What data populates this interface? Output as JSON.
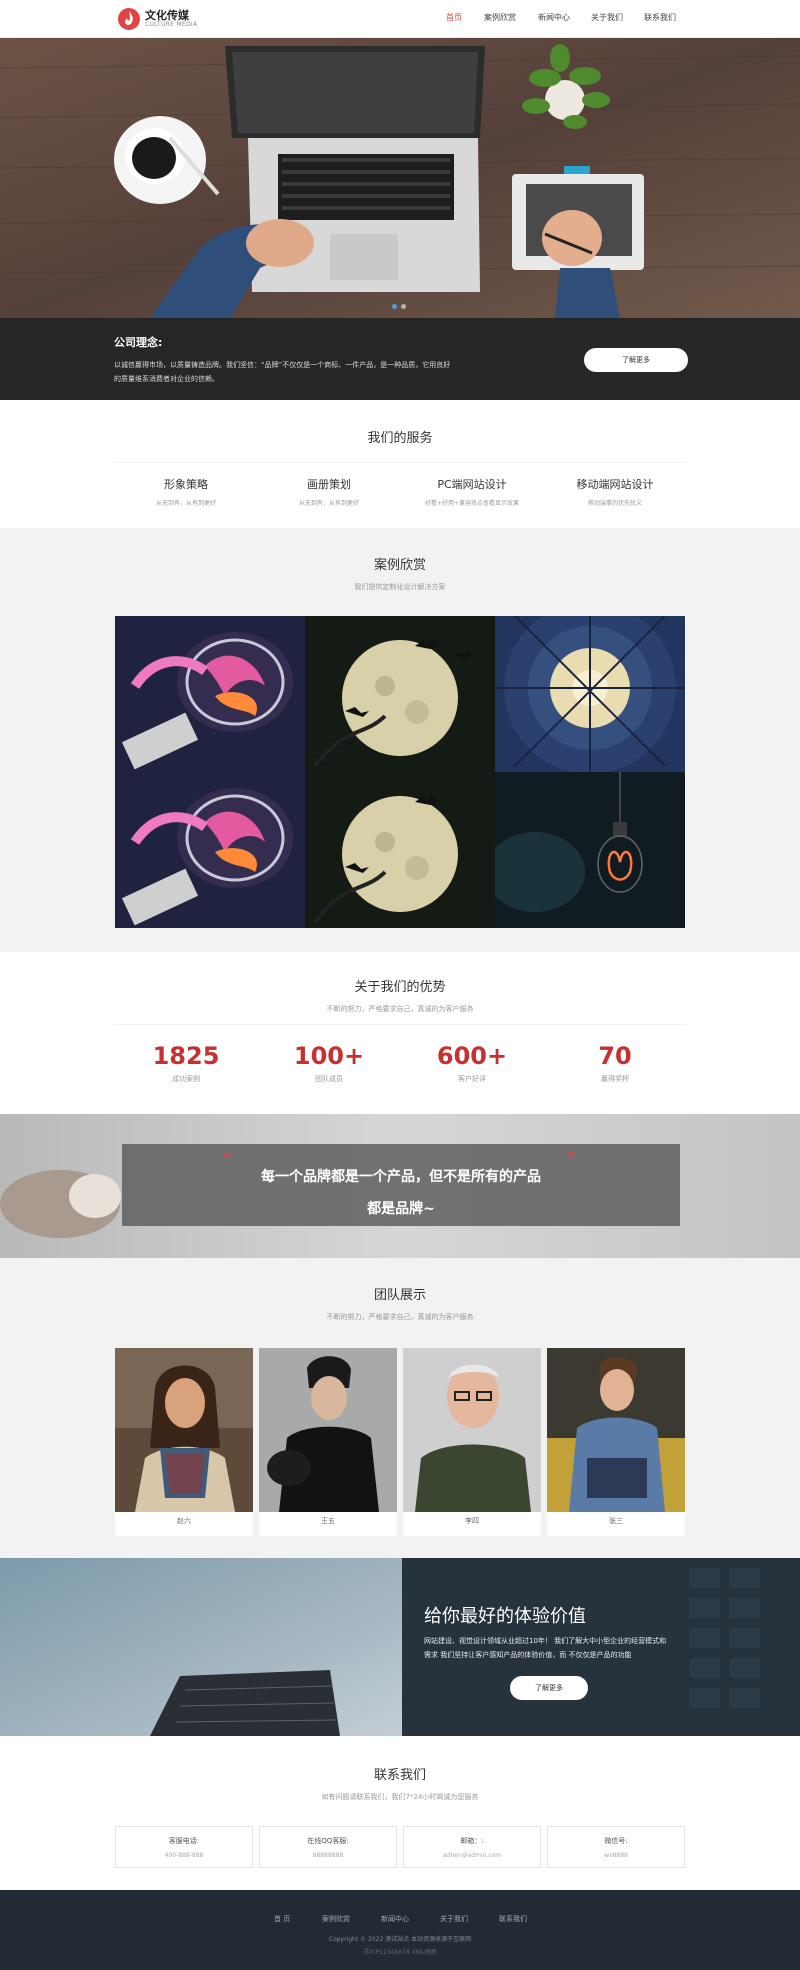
{
  "header": {
    "logo_title": "文化传媒",
    "logo_subtitle": "CULTURE MEDIA",
    "nav": [
      "首页",
      "案例欣赏",
      "新闻中心",
      "关于我们",
      "联系我们"
    ],
    "nav_active_index": 0,
    "accent_color": "#e04545"
  },
  "hero": {
    "dots": 2,
    "active_dot": 0
  },
  "concept": {
    "title": "公司理念:",
    "text": "以诚信赢得市场，以质量铸造品牌。我们坚信：“品牌”不仅仅是一个商标、一件产品，是一种品质，它用良好的质量维系消费者对企业的信赖。",
    "button": "了解更多"
  },
  "services": {
    "title": "我们的服务",
    "items": [
      {
        "name": "形象策略",
        "desc": "从无到有，从有到更好"
      },
      {
        "name": "画册策划",
        "desc": "从无到有，从有到更好"
      },
      {
        "name": "PC端网站设计",
        "desc": "好看+好用+兼容热点查看显示效果"
      },
      {
        "name": "移动端网站设计",
        "desc": "移动端事的优先优义"
      }
    ]
  },
  "cases": {
    "title": "案例欣赏",
    "subtitle": "我们提供定制化设计解决方案",
    "images": [
      "bulb-image",
      "moon-image",
      "dome-image",
      "bulb-image",
      "moon-image",
      "filament-bulb-image"
    ]
  },
  "advantages": {
    "title": "关于我们的优势",
    "subtitle": "不断的努力，严格要求自己，真诚的为客户服务",
    "stats": [
      {
        "value": "1825",
        "label": "成功案例"
      },
      {
        "value": "100+",
        "label": "团队成员"
      },
      {
        "value": "600+",
        "label": "客户好评"
      },
      {
        "value": "70",
        "label": "赢得奖杯"
      }
    ]
  },
  "quote": {
    "line1": "每一个品牌都是一个产品，但不是所有的产品",
    "line2": "都是品牌~"
  },
  "team": {
    "title": "团队展示",
    "subtitle": "不断的努力，严格要求自己，真诚的为客户服务",
    "members": [
      {
        "name": "赵六"
      },
      {
        "name": "王五"
      },
      {
        "name": "李四"
      },
      {
        "name": "张三"
      }
    ]
  },
  "value": {
    "title": "给你最好的体验价值",
    "text": "网站建设、视觉设计领域从业超过10年！ 我们了解大中小型企业的经营模式和需求 我们坚持让客户感知产品的体验价值，而 不仅仅是产品的功能",
    "button": "了解更多"
  },
  "contact": {
    "title": "联系我们",
    "subtitle": "如有问题请联系我们，我们7*24小时竭诚为您服务",
    "items": [
      {
        "label": "客服电话:",
        "value": "400-888-888"
      },
      {
        "label": "在线QQ客服:",
        "value": "88888888"
      },
      {
        "label": "邮箱：:",
        "value": "admin@admin.com"
      },
      {
        "label": "微信号:",
        "value": "wx8888"
      }
    ]
  },
  "footer": {
    "links": [
      "首 页",
      "案例欣赏",
      "新闻中心",
      "关于我们",
      "联系我们"
    ],
    "copyright": "Copyright © 2022 测试站点 本站资源来源于互联网",
    "icp": "苏ICP12345678 XML地图"
  }
}
